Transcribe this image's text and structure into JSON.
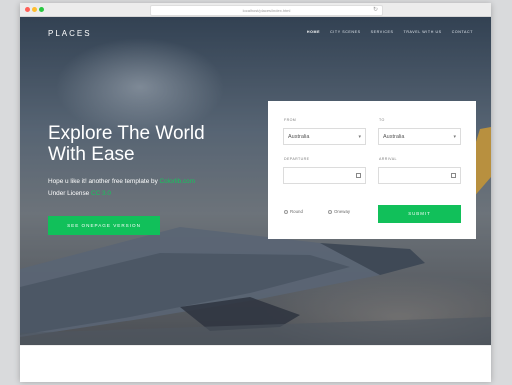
{
  "browser": {
    "url": "localhost/places/index.html",
    "dot_colors": [
      "#ff5f57",
      "#ffbd2e",
      "#28c840"
    ]
  },
  "site": {
    "brand": "PLACES",
    "nav": [
      "HOME",
      "CITY SCENES",
      "SERVICES",
      "TRAVEL WITH US",
      "CONTACT"
    ],
    "nav_active": "HOME"
  },
  "hero": {
    "title_line1": "Explore The World",
    "title_line2": "With Ease",
    "sub_line1_prefix": "Hope u like it! another free template by ",
    "sub_line1_link": "Colorlib.com",
    "sub_line2_prefix": "Under License ",
    "sub_line2_link": "CC 3.0",
    "cta_label": "SEE ONEPAGE VERSION"
  },
  "form": {
    "from_label": "FROM",
    "from_value": "Australia",
    "to_label": "TO",
    "to_value": "Australia",
    "departure_label": "DEPARTURE",
    "arrival_label": "ARRIVAL",
    "radio_round": "Round",
    "radio_oneway": "Oneway",
    "submit_label": "SUBMIT"
  },
  "colors": {
    "accent": "#11c05a",
    "link": "#18c45e"
  }
}
